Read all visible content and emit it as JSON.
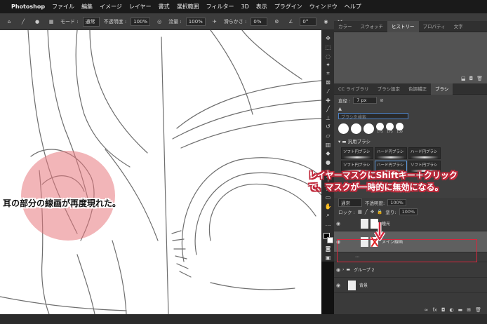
{
  "menubar": {
    "apple": "",
    "app": "Photoshop",
    "items": [
      "ファイル",
      "編集",
      "イメージ",
      "レイヤー",
      "書式",
      "選択範囲",
      "フィルター",
      "3D",
      "表示",
      "プラグイン",
      "ウィンドウ",
      "ヘルプ"
    ]
  },
  "options": {
    "mode_label": "モード :",
    "mode_value": "通常",
    "opacity_label": "不透明度 :",
    "opacity_value": "100%",
    "flow_label": "流量 :",
    "flow_value": "100%",
    "smoothing_label": "滑らかさ :",
    "smoothing_value": "0%",
    "angle_value": "0°"
  },
  "history_panel": {
    "tabs": [
      "カラー",
      "スウォッチ",
      "ヒストリー",
      "プロパティ",
      "文字"
    ],
    "active_tab": "ヒストリー"
  },
  "brush_panel": {
    "tabs": [
      "CC ライブラリ",
      "ブラシ設定",
      "色調補正",
      "ブラシ"
    ],
    "active_tab": "ブラシ",
    "size_label": "直径 :",
    "size_value": "7 px",
    "search_placeholder": "ブラシを検索",
    "preset_labels": [
      "175",
      "175",
      "150"
    ],
    "folder_label": "汎用ブラシ",
    "brushes": [
      "ソフト円ブラシ",
      "ハード円ブラシ",
      "ハード円ブラシ",
      "ソフト円ブラシ",
      "ハード円ブラシ",
      "ソフト円ブラシ"
    ],
    "selected_brush_index": 4
  },
  "layers_panel": {
    "blend_value": "通常",
    "opacity_label": "不透明度:",
    "opacity_value": "100%",
    "lock_label": "ロック :",
    "fill_label": "塗り:",
    "fill_value": "100%",
    "rows": [
      {
        "name": "瞳光",
        "type": "layer"
      },
      {
        "name": "メイン線画",
        "type": "layer",
        "selected": true,
        "mask_disabled": true
      },
      {
        "name": "グループ 2",
        "type": "group"
      },
      {
        "name": "背景",
        "type": "background"
      }
    ]
  },
  "annotations": {
    "left": "耳の部分の線画が再度現れた。",
    "right_line1": "レイヤーマスクにShiftキー＋クリック",
    "right_line2": "で、マスクが一時的に無効になる。"
  },
  "colors": {
    "highlight": "#e8787e",
    "annotation_outline": "#c0283a",
    "callout_box": "#d7263d"
  }
}
